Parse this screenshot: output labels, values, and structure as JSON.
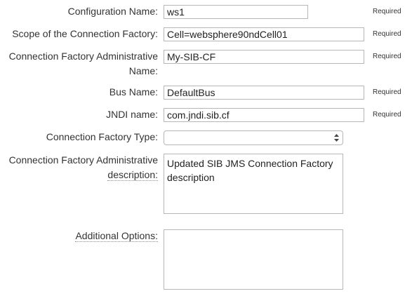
{
  "form": {
    "configuration_name": {
      "label": "Configuration Name:",
      "value": "ws1",
      "required": "Required"
    },
    "scope": {
      "label": "Scope of the Connection Factory:",
      "value": "Cell=websphere90ndCell01",
      "required": "Required"
    },
    "admin_name": {
      "label_line1": "Connection Factory Administrative",
      "label_line2": "Name:",
      "value": "My-SIB-CF",
      "required": "Required"
    },
    "bus_name": {
      "label": "Bus Name:",
      "value": "DefaultBus",
      "required": "Required"
    },
    "jndi_name": {
      "label": "JNDI name:",
      "value": "com.jndi.sib.cf",
      "required": "Required"
    },
    "factory_type": {
      "label": "Connection Factory Type:",
      "value": ""
    },
    "admin_description": {
      "label_line1": "Connection Factory Administrative",
      "label_line2": "description:",
      "value": "Updated SIB JMS Connection Factory description"
    },
    "additional_options": {
      "label": "Additional Options:",
      "value": ""
    }
  },
  "icons": {
    "select_arrows": "up-down-chevron-icon"
  }
}
